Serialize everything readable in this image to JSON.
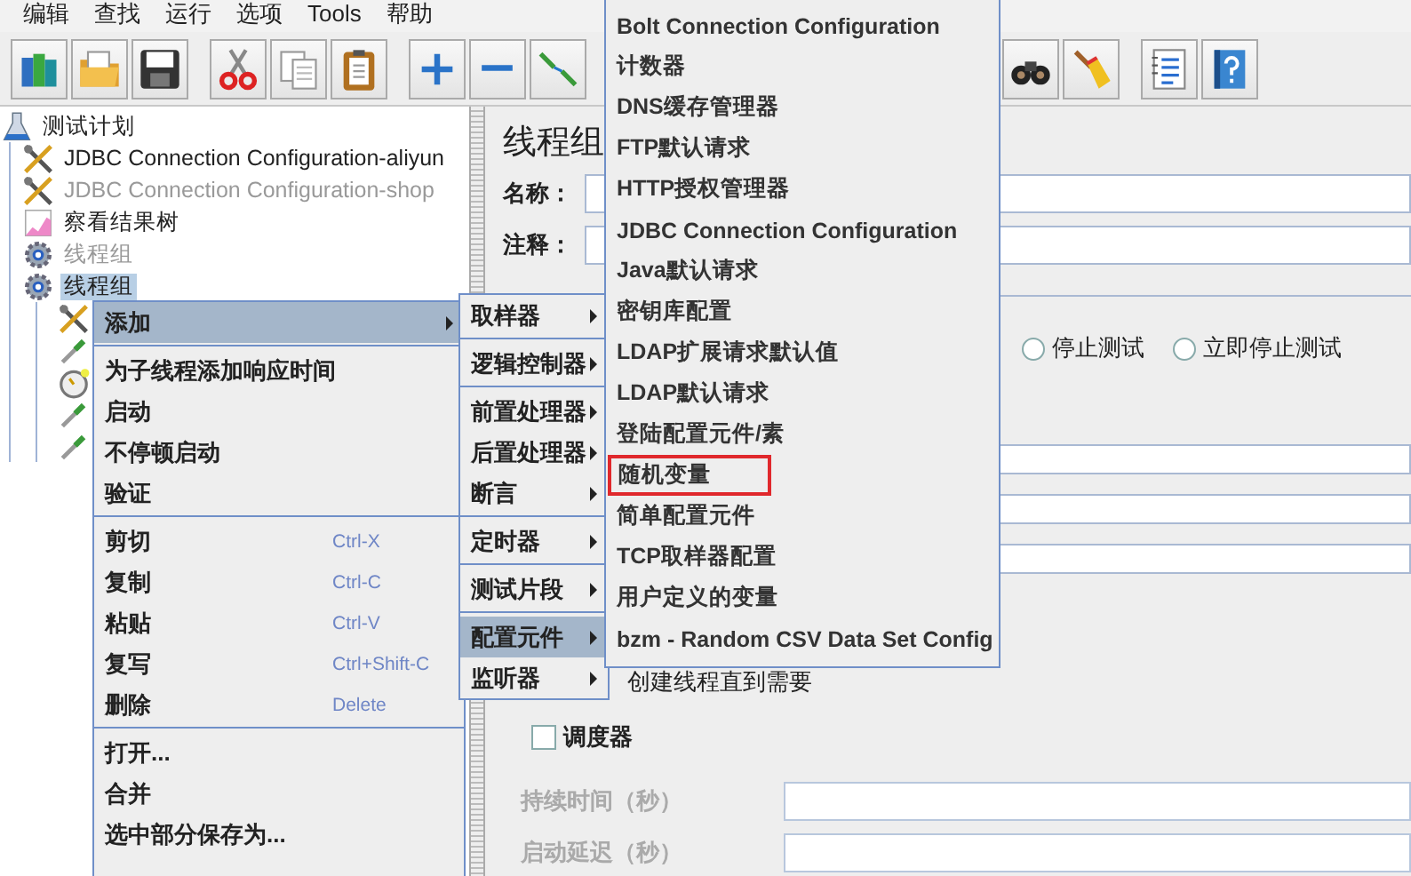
{
  "menu_bar": [
    {
      "label": "编辑"
    },
    {
      "label": "查找"
    },
    {
      "label": "运行"
    },
    {
      "label": "选项"
    },
    {
      "label": "Tools"
    },
    {
      "label": "帮助"
    }
  ],
  "toolbar": [
    [
      {
        "kind": "books"
      },
      {
        "kind": "folder"
      },
      {
        "kind": "save"
      }
    ],
    [
      {
        "kind": "cut"
      },
      {
        "kind": "copy"
      },
      {
        "kind": "paste"
      }
    ],
    [
      {
        "kind": "plus"
      },
      {
        "kind": "minus"
      },
      {
        "kind": "toggle"
      }
    ],
    [
      {
        "kind": "binoculars"
      },
      {
        "kind": "broom"
      }
    ],
    [
      {
        "kind": "list"
      },
      {
        "kind": "help"
      }
    ]
  ],
  "tree": {
    "label": "测试计划",
    "kind": "flask",
    "disabled": false,
    "selected": false,
    "children": [
      {
        "label": "JDBC Connection Configuration-aliyun",
        "kind": "tools",
        "disabled": false,
        "selected": false
      },
      {
        "label": "JDBC Connection Configuration-shop",
        "kind": "tools",
        "disabled": true,
        "selected": false
      },
      {
        "label": "察看结果树",
        "kind": "chart",
        "disabled": false,
        "selected": false
      },
      {
        "label": "线程组",
        "kind": "gear",
        "disabled": true,
        "selected": false
      },
      {
        "label": "线程组",
        "kind": "gear",
        "disabled": false,
        "selected": true,
        "children": [
          {
            "kind": "tools"
          },
          {
            "kind": "dropper"
          },
          {
            "kind": "timer"
          },
          {
            "kind": "dropper"
          },
          {
            "kind": "dropper"
          }
        ]
      }
    ]
  },
  "panel": {
    "title": "线程组",
    "name_label": "名称：",
    "comment_label": "注释：",
    "error_actions": [
      {
        "label": "停止测试",
        "selected": false
      },
      {
        "label": "立即停止测试",
        "selected": false
      }
    ],
    "delay_creation": {
      "label": "创建线程直到需要"
    },
    "scheduler": {
      "label": "调度器",
      "checked": false
    },
    "scheduler_fields": [
      {
        "label": "持续时间（秒）",
        "disabled": true
      },
      {
        "label": "启动延迟（秒）",
        "disabled": true
      }
    ]
  },
  "context_menu": {
    "groups": [
      [
        {
          "label": "添加",
          "submenu": true,
          "selected": true
        }
      ],
      [
        {
          "label": "为子线程添加响应时间",
          "selected": false
        },
        {
          "label": "启动",
          "selected": false
        },
        {
          "label": "不停顿启动",
          "selected": false
        },
        {
          "label": "验证",
          "selected": false
        }
      ],
      [
        {
          "label": "剪切",
          "shortcut": "Ctrl-X",
          "selected": false
        },
        {
          "label": "复制",
          "shortcut": "Ctrl-C",
          "selected": false
        },
        {
          "label": "粘贴",
          "shortcut": "Ctrl-V",
          "selected": false
        },
        {
          "label": "复写",
          "shortcut": "Ctrl+Shift-C",
          "selected": false
        },
        {
          "label": "删除",
          "shortcut": "Delete",
          "selected": false
        }
      ],
      [
        {
          "label": "打开...",
          "selected": false
        },
        {
          "label": "合并",
          "selected": false
        },
        {
          "label": "选中部分保存为...",
          "selected": false
        }
      ]
    ]
  },
  "add_menu": {
    "groups": [
      [
        {
          "label": "取样器",
          "submenu": true,
          "selected": false
        }
      ],
      [
        {
          "label": "逻辑控制器",
          "submenu": true,
          "selected": false
        }
      ],
      [
        {
          "label": "前置处理器",
          "submenu": true,
          "selected": false
        },
        {
          "label": "后置处理器",
          "submenu": true,
          "selected": false
        },
        {
          "label": "断言",
          "submenu": true,
          "selected": false
        }
      ],
      [
        {
          "label": "定时器",
          "submenu": true,
          "selected": false
        }
      ],
      [
        {
          "label": "测试片段",
          "submenu": true,
          "selected": false
        }
      ],
      [
        {
          "label": "配置元件",
          "submenu": true,
          "selected": true
        },
        {
          "label": "监听器",
          "submenu": true,
          "selected": false
        }
      ]
    ]
  },
  "config_menu": {
    "items": [
      {
        "label": "Bolt Connection Configuration",
        "highlighted": false
      },
      {
        "label": "计数器",
        "highlighted": false
      },
      {
        "label": "DNS缓存管理器",
        "highlighted": false
      },
      {
        "label": "FTP默认请求",
        "highlighted": false
      },
      {
        "label": "HTTP授权管理器",
        "highlighted": false
      },
      {
        "label": "JDBC Connection Configuration",
        "highlighted": false
      },
      {
        "label": "Java默认请求",
        "highlighted": false
      },
      {
        "label": "密钥库配置",
        "highlighted": false
      },
      {
        "label": "LDAP扩展请求默认值",
        "highlighted": false
      },
      {
        "label": "LDAP默认请求",
        "highlighted": false
      },
      {
        "label": "登陆配置元件/素",
        "highlighted": false
      },
      {
        "label": "随机变量",
        "highlighted": true
      },
      {
        "label": "简单配置元件",
        "highlighted": false
      },
      {
        "label": "TCP取样器配置",
        "highlighted": false
      },
      {
        "label": "用户定义的变量",
        "highlighted": false
      },
      {
        "label": "bzm - Random CSV Data Set Config",
        "highlighted": false
      }
    ]
  }
}
